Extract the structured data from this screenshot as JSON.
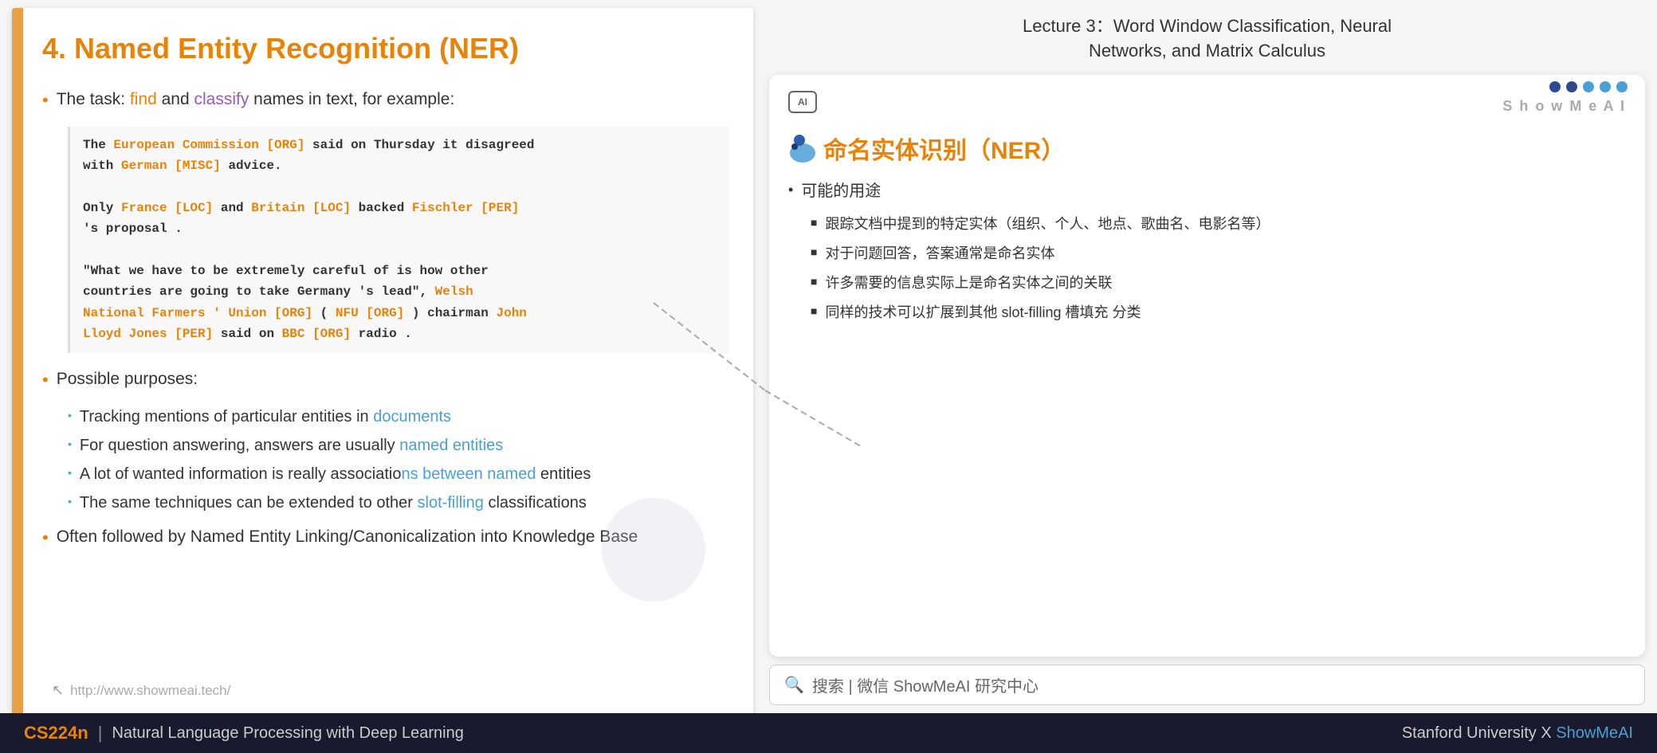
{
  "slide": {
    "title": "4. Named Entity Recognition (NER)",
    "task_intro": "The task: ",
    "task_find": "find",
    "task_and": " and ",
    "task_classify": "classify",
    "task_rest": " names in text, for example:",
    "code_lines": [
      {
        "parts": [
          {
            "text": "The ",
            "type": "normal"
          },
          {
            "text": "European Commission [ORG]",
            "type": "highlight"
          },
          {
            "text": " said on Thursday it disagreed",
            "type": "normal"
          }
        ]
      },
      {
        "parts": [
          {
            "text": "with ",
            "type": "normal"
          },
          {
            "text": "German [MISC]",
            "type": "highlight"
          },
          {
            "text": " advice.",
            "type": "normal"
          }
        ]
      },
      {
        "parts": []
      },
      {
        "parts": [
          {
            "text": "Only ",
            "type": "normal"
          },
          {
            "text": "France [LOC]",
            "type": "highlight"
          },
          {
            "text": " and ",
            "type": "normal"
          },
          {
            "text": "Britain [LOC]",
            "type": "highlight"
          },
          {
            "text": " backed ",
            "type": "normal"
          },
          {
            "text": "Fischler [PER]",
            "type": "highlight"
          }
        ]
      },
      {
        "parts": [
          {
            "text": "'s proposal .",
            "type": "normal"
          }
        ]
      },
      {
        "parts": []
      },
      {
        "parts": [
          {
            "text": "\"What we have to be extremely careful of is how other",
            "type": "normal"
          }
        ]
      },
      {
        "parts": [
          {
            "text": "countries are going to take Germany 's lead\", ",
            "type": "normal"
          },
          {
            "text": "Welsh",
            "type": "highlight"
          }
        ]
      },
      {
        "parts": [
          {
            "text": "National Farmers ' Union [ORG]",
            "type": "highlight"
          },
          {
            "text": " ( ",
            "type": "normal"
          },
          {
            "text": "NFU [ORG]",
            "type": "highlight"
          },
          {
            "text": " ) chairman ",
            "type": "normal"
          },
          {
            "text": "John",
            "type": "highlight"
          }
        ]
      },
      {
        "parts": [
          {
            "text": "Lloyd Jones [PER]",
            "type": "highlight"
          },
          {
            "text": " said on ",
            "type": "normal"
          },
          {
            "text": "BBC [ORG]",
            "type": "highlight"
          },
          {
            "text": " radio .",
            "type": "normal"
          }
        ]
      }
    ],
    "possible_purposes": "Possible purposes:",
    "sub_bullets": [
      {
        "text_normal": "Tracking mentions of particular entities in ",
        "text_highlight": "documents",
        "text_end": ""
      },
      {
        "text_normal": "For question answering, answers are usually ",
        "text_highlight": "named entities",
        "text_end": ""
      },
      {
        "text_normal": "A lot of wanted information is really associations",
        "text_highlight": "n between named",
        "text_end": " entities"
      },
      {
        "text_normal": "The same techniques can be extended to other ",
        "text_highlight": "slot-filling",
        "text_end": " classifications"
      }
    ],
    "last_bullet": "Often followed by Named Entity Linking/Canonicalization into Knowledge Base",
    "footer_url": "http://www.showmeai.tech/"
  },
  "lecture_header": {
    "line1": "Lecture 3：Word Window Classification, Neural",
    "line2": "Networks, and Matrix Calculus"
  },
  "annotation_card": {
    "title": "命名实体识别（NER）",
    "showmeai_label": "S h o w M e A I",
    "ai_badge": "AI",
    "main_bullet": "可能的用途",
    "sub_items": [
      "跟踪文档中提到的特定实体（组织、个人、地点、歌曲名、电影名等）",
      "对于问题回答，答案通常是命名实体",
      "许多需要的信息实际上是命名实体之间的关联",
      "同样的技术可以扩展到其他 slot-filling 槽填充 分类"
    ]
  },
  "search_bar": {
    "placeholder": "搜索 | 微信 ShowMeAI 研究中心"
  },
  "footer": {
    "cs224n": "CS224n",
    "divider": "|",
    "subtitle": "Natural Language Processing with Deep Learning",
    "right": "Stanford University",
    "x": "X",
    "showmeai": "ShowMeAI"
  }
}
